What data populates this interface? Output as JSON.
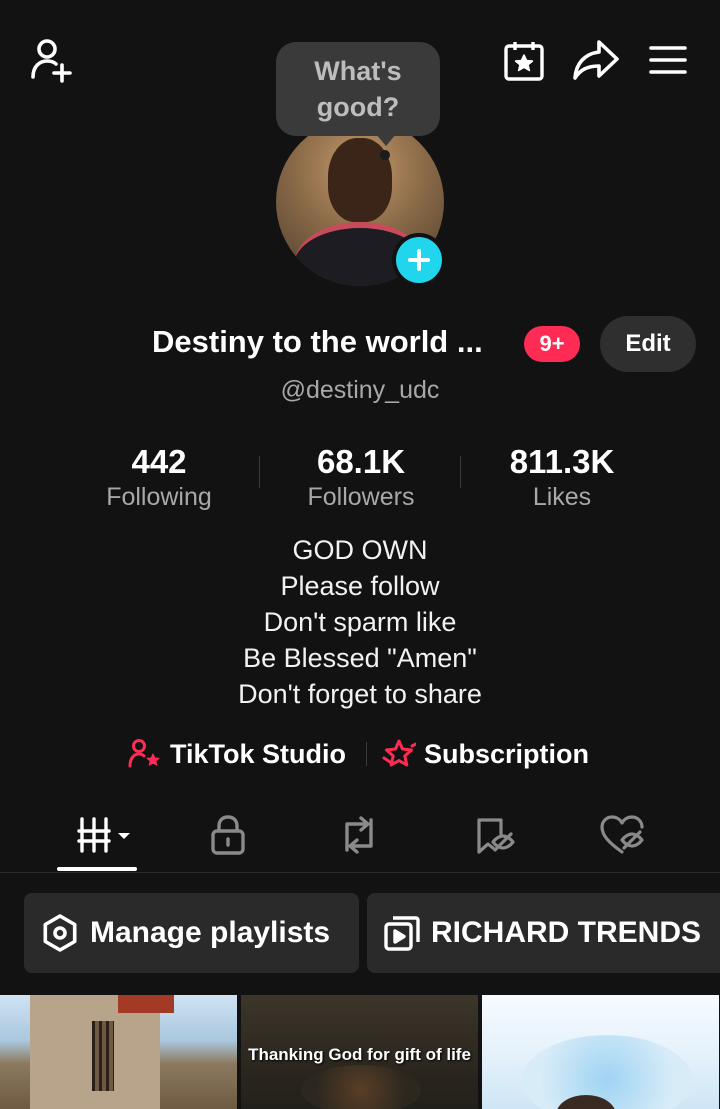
{
  "header": {
    "add_friend_icon": "person-plus-icon",
    "calendar_icon": "calendar-star-icon",
    "share_icon": "share-arrow-icon",
    "menu_icon": "hamburger-menu-icon"
  },
  "bubble": {
    "line1": "What's",
    "line2": "good?"
  },
  "profile": {
    "display_name": "Destiny to the world ...",
    "notification_badge": "9+",
    "edit_label": "Edit",
    "username": "@destiny_udc"
  },
  "stats": [
    {
      "value": "442",
      "label": "Following"
    },
    {
      "value": "68.1K",
      "label": "Followers"
    },
    {
      "value": "811.3K",
      "label": "Likes"
    }
  ],
  "bio": [
    "GOD OWN",
    "Please follow",
    "Don't sparm like",
    "Be Blessed \"Amen\"",
    "Don't forget to share"
  ],
  "links": {
    "studio": "TikTok Studio",
    "subscription": "Subscription"
  },
  "tabs": [
    "videos-grid-icon",
    "private-lock-icon",
    "repost-icon",
    "saved-hidden-icon",
    "liked-hidden-icon"
  ],
  "playlists": {
    "manage": "Manage playlists",
    "richard": "RICHARD TRENDS"
  },
  "videos": [
    {
      "caption": ""
    },
    {
      "caption": "Thanking God for gift of life"
    },
    {
      "caption": ""
    }
  ],
  "colors": {
    "background": "#121212",
    "accent_cyan": "#20d5ec",
    "accent_red": "#fe2c55",
    "muted": "#a8a8a8"
  }
}
